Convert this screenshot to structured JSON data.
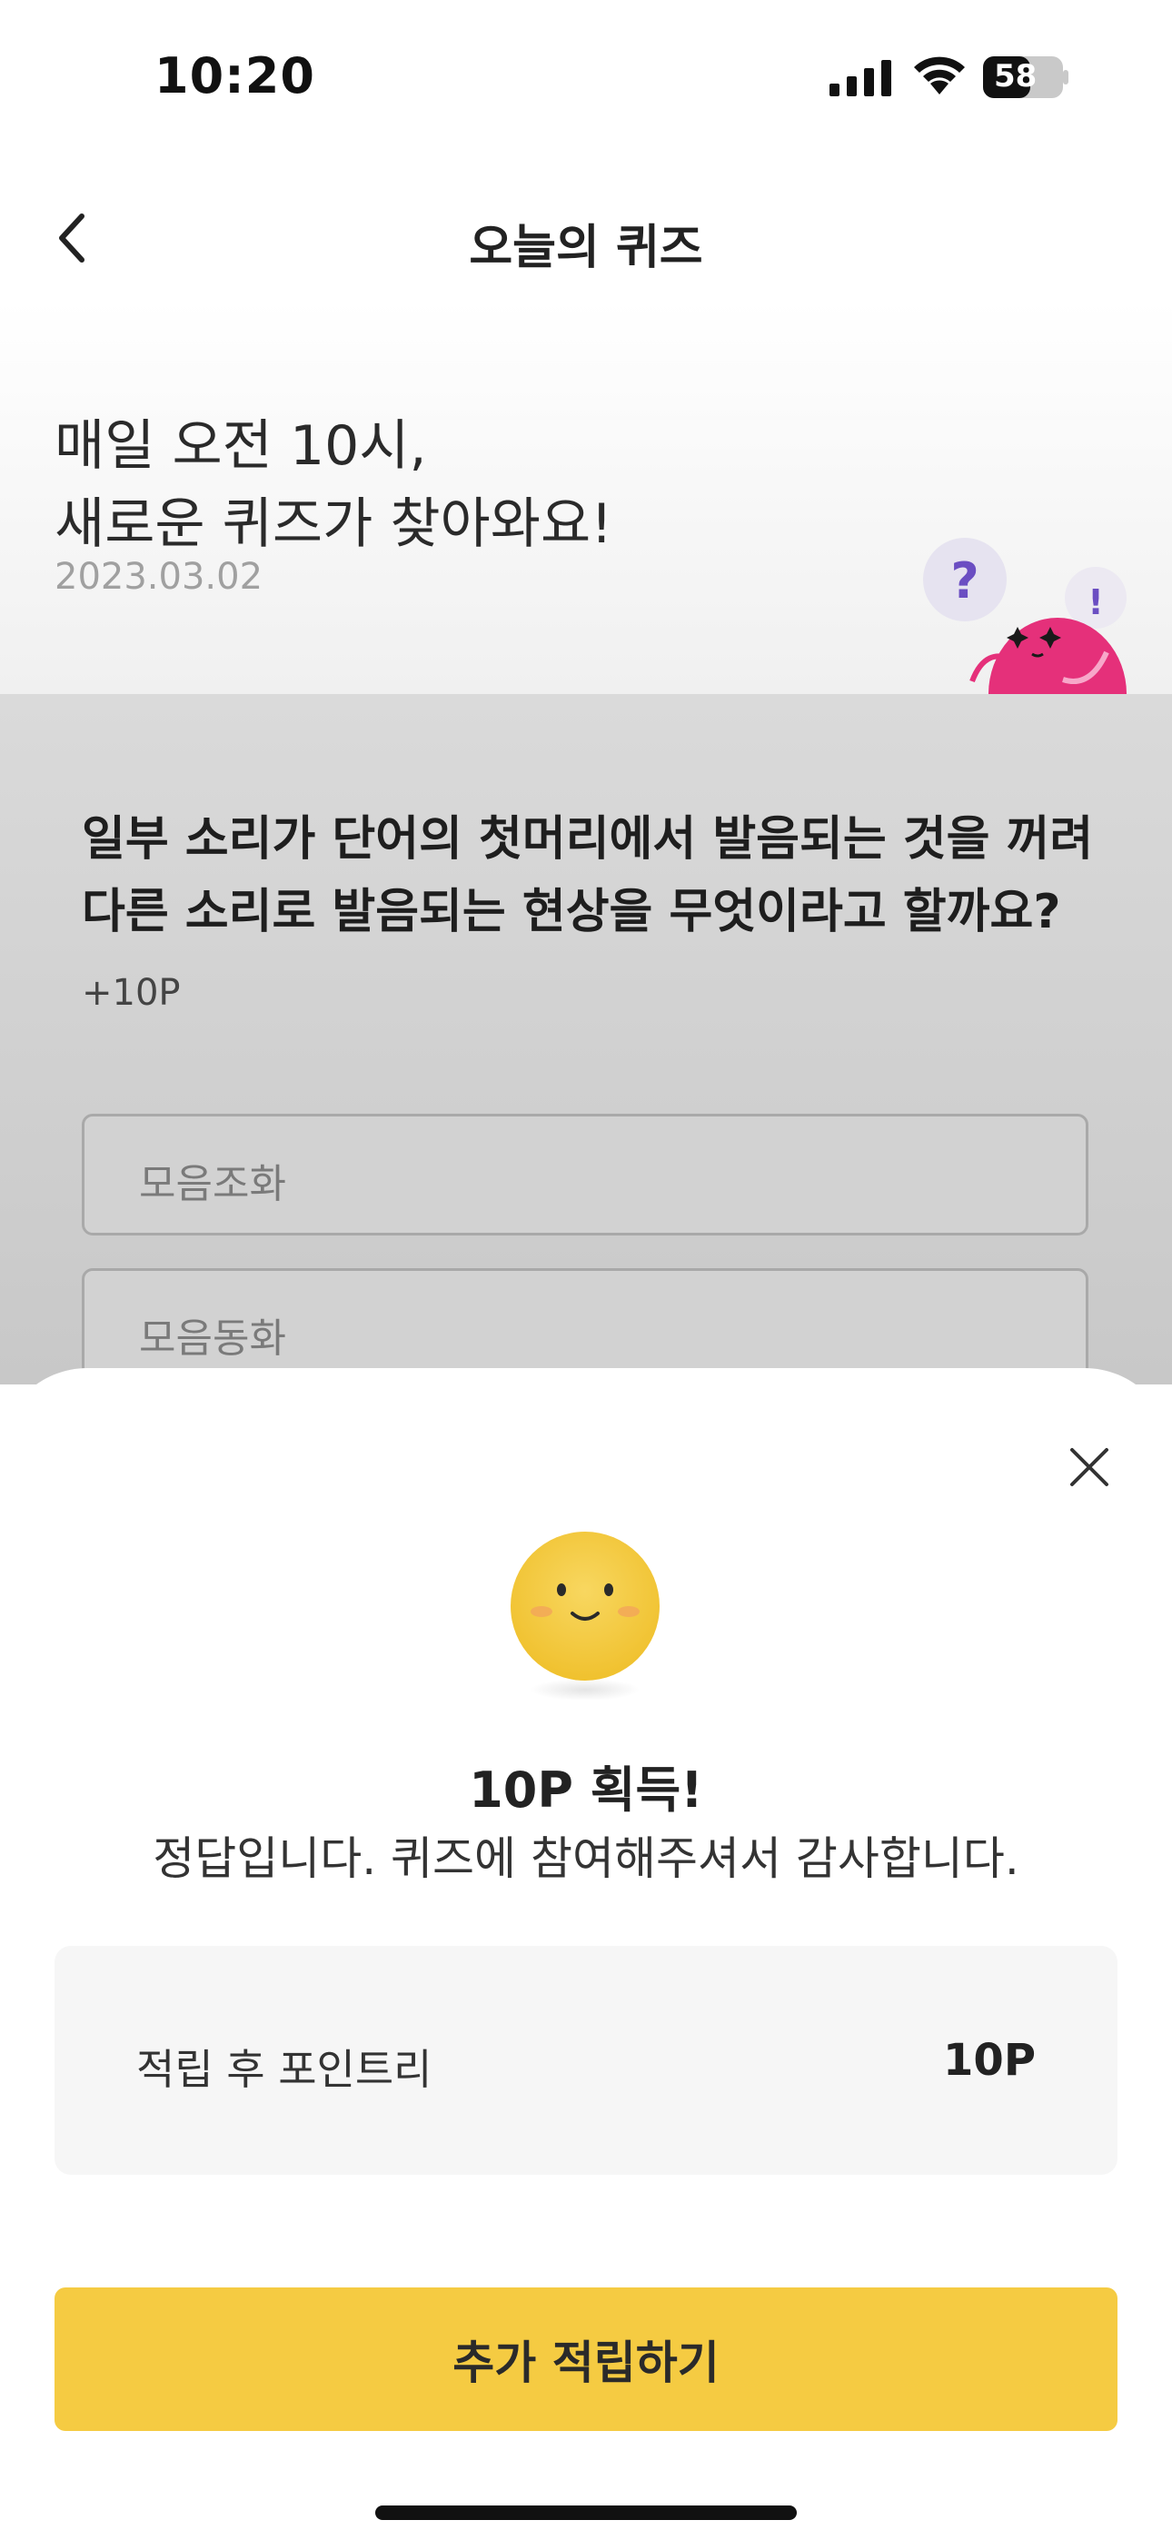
{
  "status_bar": {
    "time": "10:20",
    "battery": "58"
  },
  "nav": {
    "title": "오늘의 퀴즈"
  },
  "hero": {
    "line1": "매일 오전 10시,",
    "line2": "새로운 퀴즈가 찾아와요!",
    "date": "2023.03.02"
  },
  "quiz": {
    "question": "일부 소리가 단어의 첫머리에서 발음되는 것을 꺼려 다른 소리로 발음되는 현상을 무엇이라고 할까요?",
    "points": "+10P",
    "options": [
      {
        "label": "모음조화"
      },
      {
        "label": "모음동화"
      }
    ]
  },
  "sheet": {
    "title": "10P 획득!",
    "message": "정답입니다. 퀴즈에 참여해주셔서 감사합니다.",
    "balance_label": "적립 후 포인트리",
    "balance_value": "10P",
    "cta_label": "추가 적립하기"
  },
  "colors": {
    "accent": "#f5cb42",
    "mascot": "#e5307a",
    "emoji": "#f3c93d"
  }
}
